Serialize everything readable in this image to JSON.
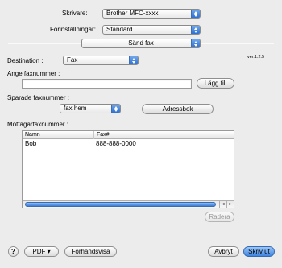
{
  "header": {
    "printer_label": "Skrivare:",
    "printer_value": "Brother MFC-xxxx",
    "presets_label": "Förinställningar:",
    "presets_value": "Standard"
  },
  "panel": {
    "value": "Sänd fax",
    "version": "ver.1.2.5"
  },
  "fax": {
    "destination_label": "Destination :",
    "destination_value": "Fax",
    "enter_number_label": "Ange faxnummer :",
    "enter_number_value": "",
    "add_button": "Lägg till",
    "saved_numbers_label": "Sparade faxnummer :",
    "saved_numbers_value": "fax hem",
    "address_book_button": "Adressbok",
    "recipients_label": "Mottagarfaxnummer :",
    "table": {
      "columns": [
        "Namn",
        "Fax#"
      ],
      "rows": [
        {
          "name": "Bob",
          "fax": "888-888-0000"
        }
      ]
    },
    "delete_button": "Radera"
  },
  "footer": {
    "help": "?",
    "pdf_button": "PDF ▾",
    "preview_button": "Förhandsvisa",
    "cancel_button": "Avbryt",
    "print_button": "Skriv ut"
  }
}
